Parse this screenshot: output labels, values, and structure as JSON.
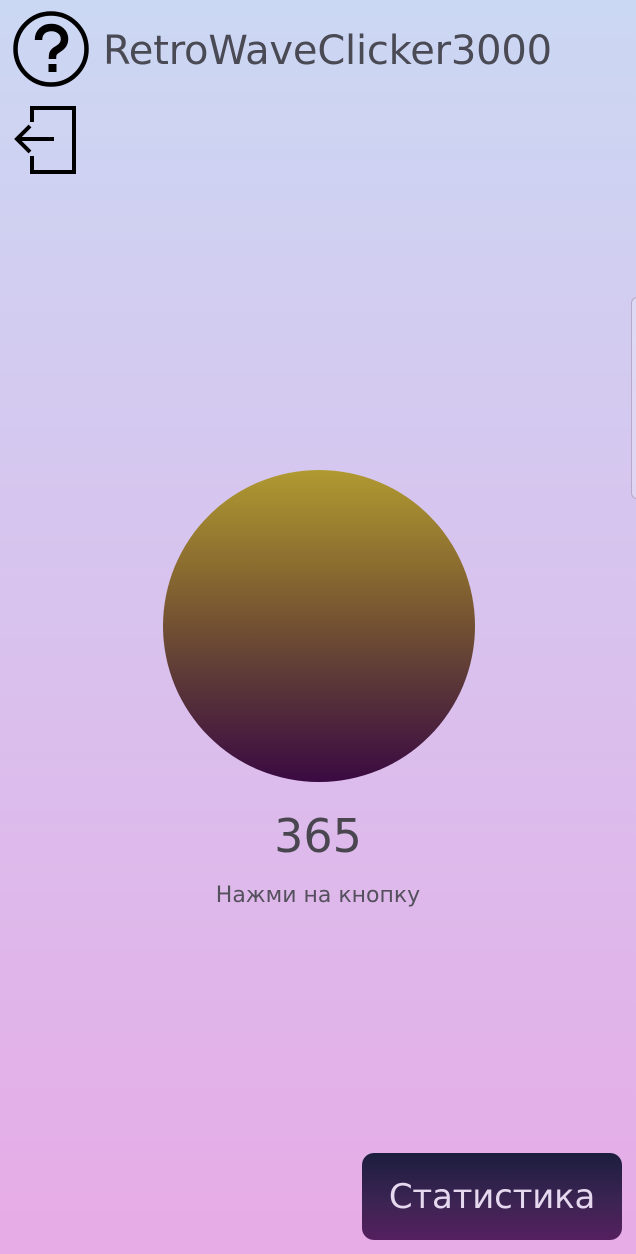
{
  "app": {
    "title": "RetroWaveClicker3000"
  },
  "toolbar": {
    "help_icon": "question-circle-icon",
    "logout_icon": "logout-icon"
  },
  "clicker": {
    "count": "365",
    "hint": "Нажми на кнопку",
    "colors": {
      "top": "#b09a31",
      "bottom": "#3a0a42"
    }
  },
  "stats_button": {
    "label": "Статистика"
  },
  "theme": {
    "background_top": "#cbd8f3",
    "background_bottom": "#e7abe6",
    "text": "#4a4a55"
  }
}
